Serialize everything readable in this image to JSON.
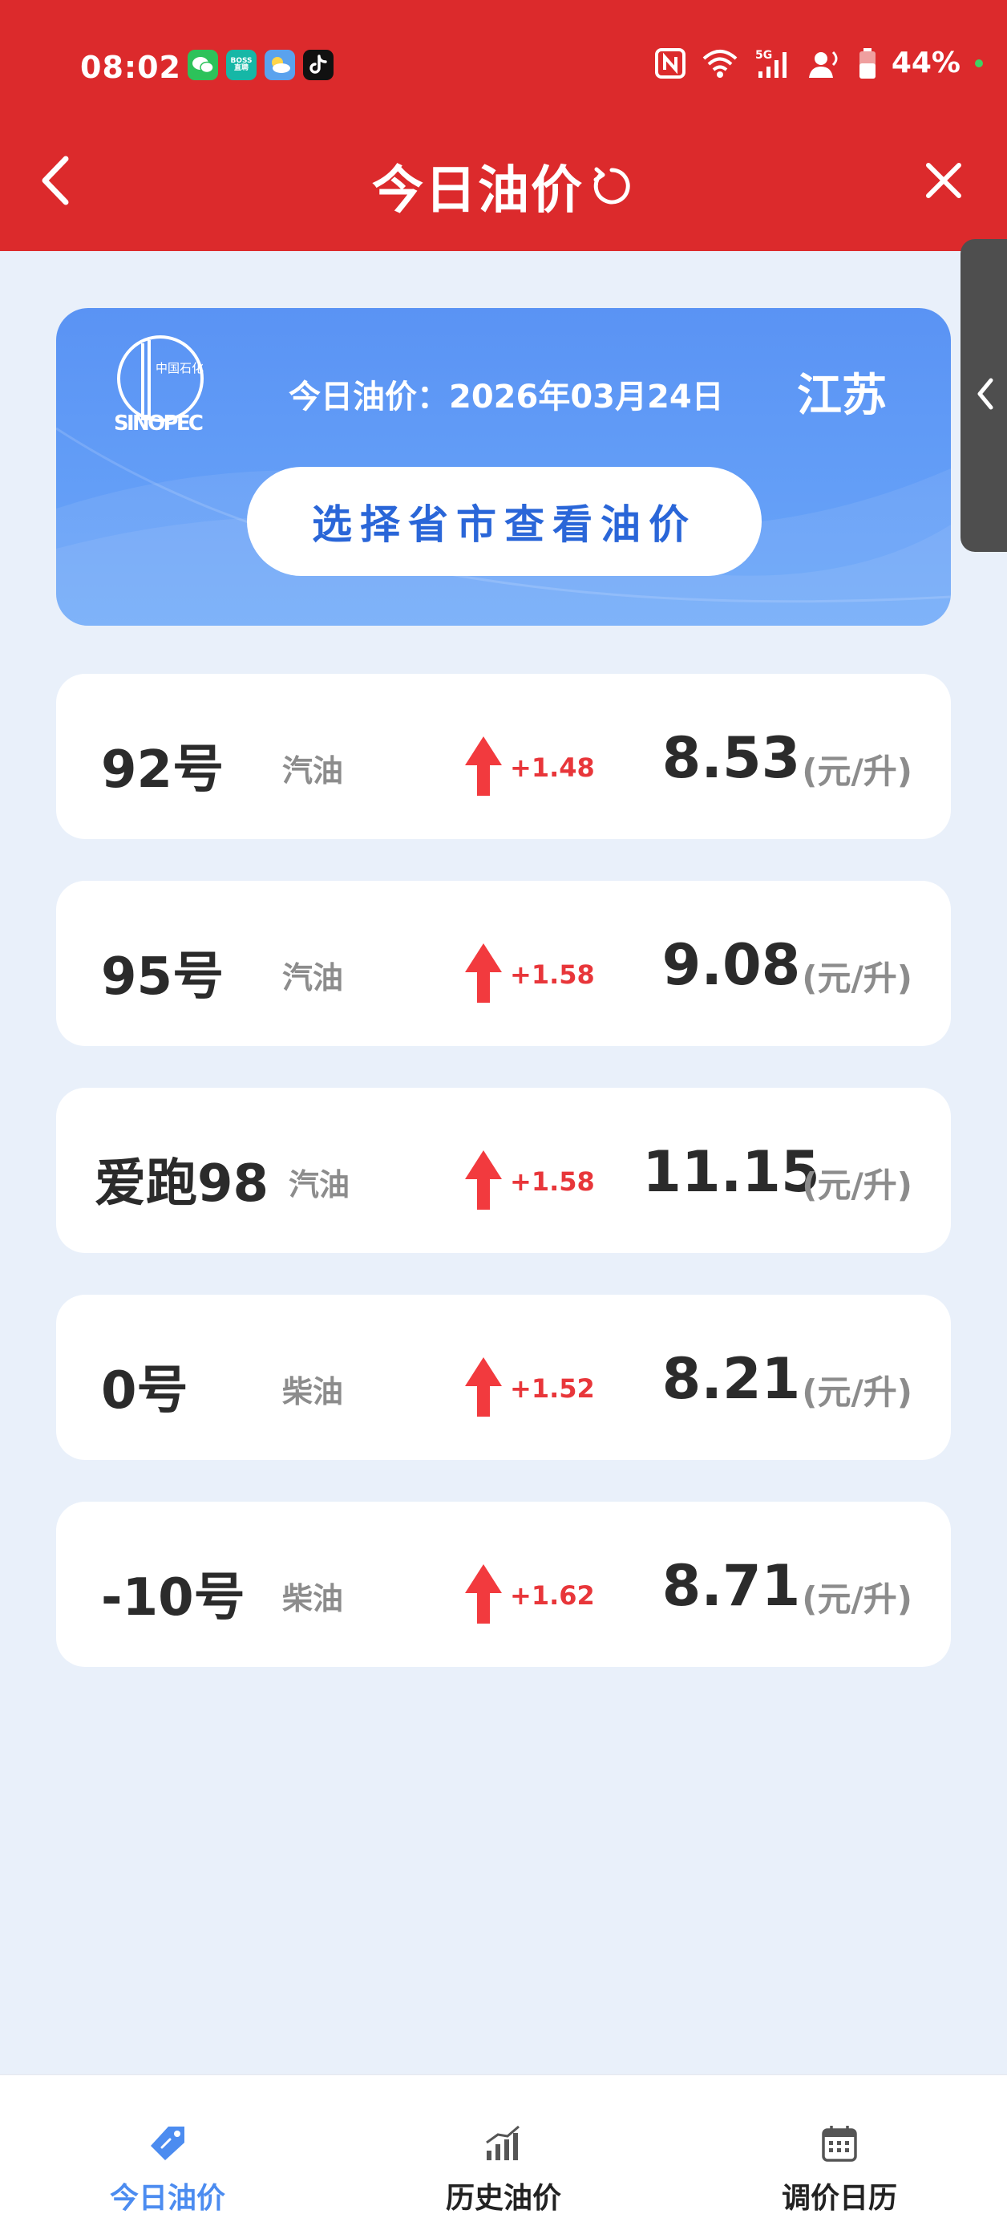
{
  "status_bar": {
    "time": "08:02",
    "battery": "44%",
    "app_icons": [
      "wechat-icon",
      "boss-zhipin-icon",
      "weather-icon",
      "tiktok-icon"
    ],
    "boss_label_top": "BOSS",
    "boss_label_bottom": "直聘",
    "system_icons": [
      "nfc-icon",
      "wifi-icon",
      "5g-signal-icon",
      "hotspot-user-icon",
      "battery-icon"
    ]
  },
  "navbar": {
    "title": "今日油价",
    "back_icon": "chevron-left-icon",
    "refresh_icon": "refresh-icon",
    "close_icon": "close-icon"
  },
  "banner": {
    "date_text": "今日油价：2026年03月24日",
    "province": "江苏",
    "select_button": "选择省市查看油价",
    "logo": "sinopec-logo",
    "logo_text": "SINOPEC",
    "logo_chinese": "中国石化"
  },
  "prices": [
    {
      "grade": "92号",
      "fuel": "汽油",
      "change": "+1.48",
      "price": "8.53",
      "unit": "(元/升)"
    },
    {
      "grade": "95号",
      "fuel": "汽油",
      "change": "+1.58",
      "price": "9.08",
      "unit": "(元/升)"
    },
    {
      "grade": "爱跑98",
      "fuel": "汽油",
      "change": "+1.58",
      "price": "11.15",
      "unit": "(元/升)"
    },
    {
      "grade": "0号",
      "fuel": "柴油",
      "change": "+1.52",
      "price": "8.21",
      "unit": "(元/升)"
    },
    {
      "grade": "-10号",
      "fuel": "柴油",
      "change": "+1.62",
      "price": "8.71",
      "unit": "(元/升)"
    }
  ],
  "tabs": [
    {
      "label": "今日油价",
      "icon": "price-tag-icon",
      "active": true
    },
    {
      "label": "历史油价",
      "icon": "bar-chart-icon",
      "active": false
    },
    {
      "label": "调价日历",
      "icon": "calendar-icon",
      "active": false
    }
  ],
  "colors": {
    "header_red": "#dc2a2c",
    "banner_blue": "#5a93f4",
    "up_red": "#e8363a",
    "active_tab_blue": "#4c8cf0",
    "page_background": "#e9f0fa"
  }
}
